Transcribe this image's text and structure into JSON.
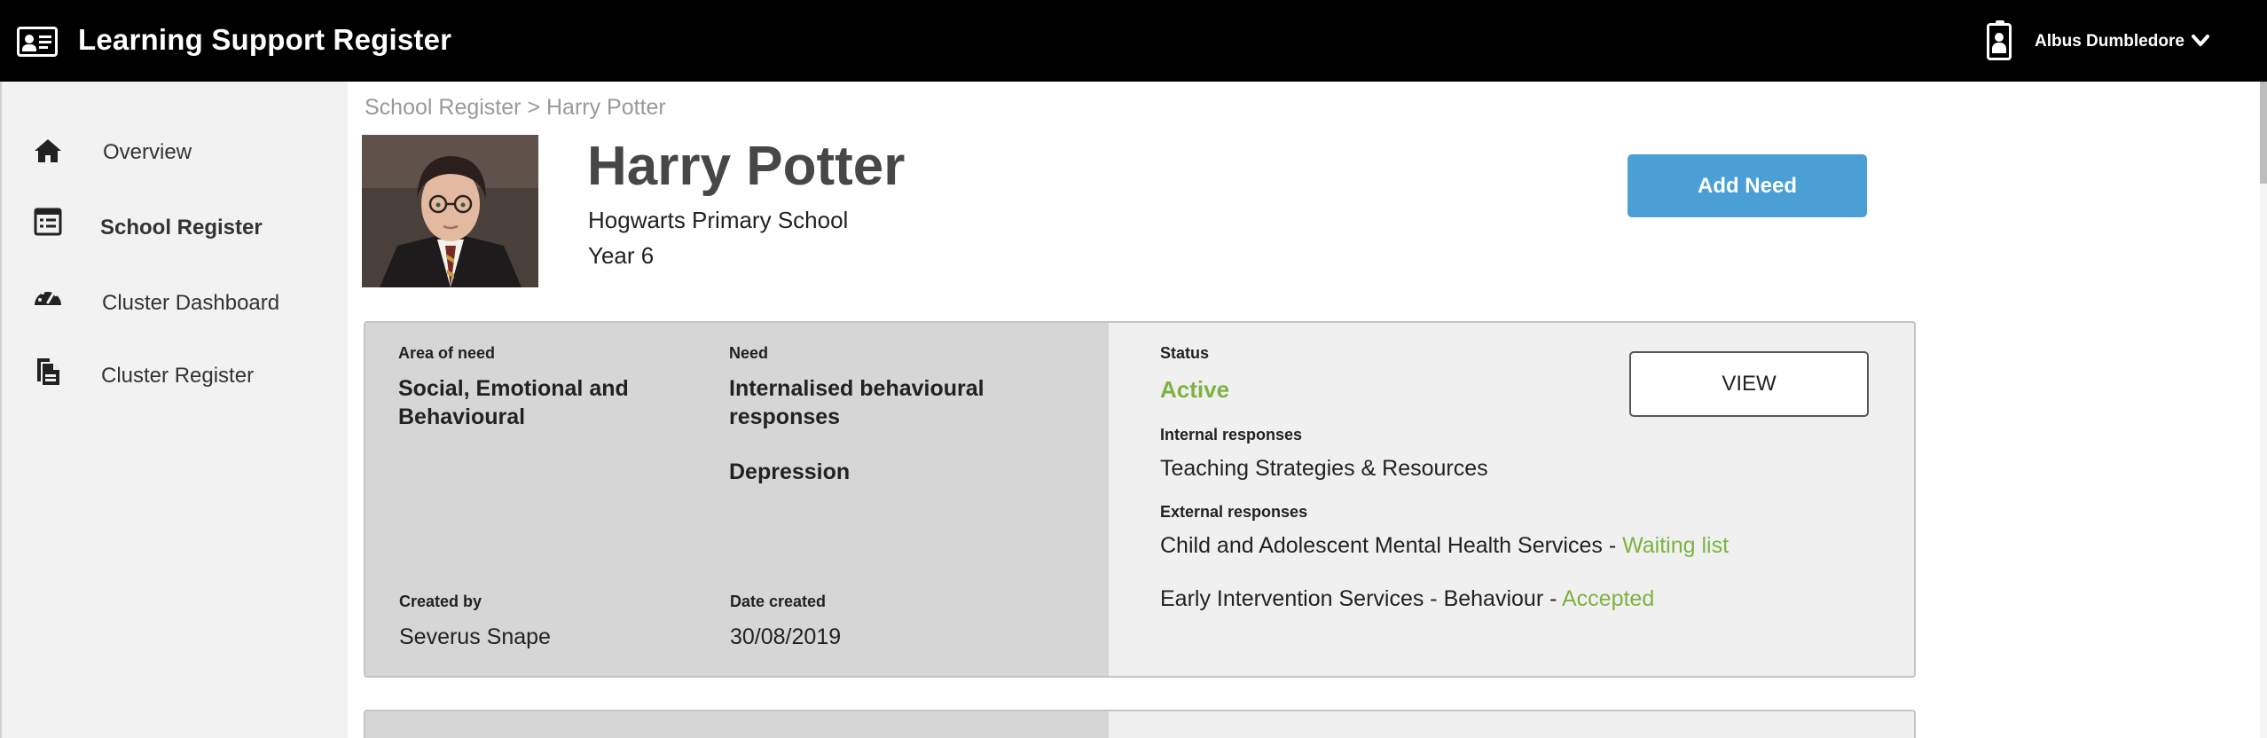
{
  "header": {
    "app_title": "Learning Support Register",
    "app_icon": "id-card-icon",
    "user_icon": "badge-icon",
    "user_name": "Albus Dumbledore",
    "user_menu_icon": "chevron-down-icon",
    "background": "#000000"
  },
  "sidebar": {
    "items": [
      {
        "label": "Overview",
        "icon": "home-icon",
        "active": false
      },
      {
        "label": "School Register",
        "icon": "register-icon",
        "active": true
      },
      {
        "label": "Cluster Dashboard",
        "icon": "dashboard-gauge-icon",
        "active": false
      },
      {
        "label": "Cluster Register",
        "icon": "documents-icon",
        "active": false
      }
    ]
  },
  "breadcrumb": {
    "parent": "School Register",
    "separator": ">",
    "current": "Harry Potter"
  },
  "student": {
    "name": "Harry Potter",
    "school": "Hogwarts Primary School",
    "year": "Year 6",
    "photo": "student-photo"
  },
  "actions": {
    "add_need": "Add Need",
    "add_need_color": "#4a9fd5"
  },
  "need_card": {
    "area_label": "Area of need",
    "area_value": "Social, Emotional and Behavioural",
    "need_label": "Need",
    "need_values": [
      "Internalised behavioural responses",
      "Depression"
    ],
    "created_by_label": "Created by",
    "created_by_value": "Severus Snape",
    "date_created_label": "Date created",
    "date_created_value": "30/08/2019",
    "status_label": "Status",
    "status_value": "Active",
    "status_color": "#7cb342",
    "view_button": "VIEW",
    "internal_label": "Internal responses",
    "internal_value": "Teaching Strategies & Resources",
    "external_label": "External responses",
    "external_responses": [
      {
        "service": "Child and Adolescent Mental Health Services",
        "separator": " - ",
        "status": "Waiting list"
      },
      {
        "service": "Early Intervention Services - Behaviour",
        "separator": " - ",
        "status": "Accepted"
      }
    ]
  }
}
